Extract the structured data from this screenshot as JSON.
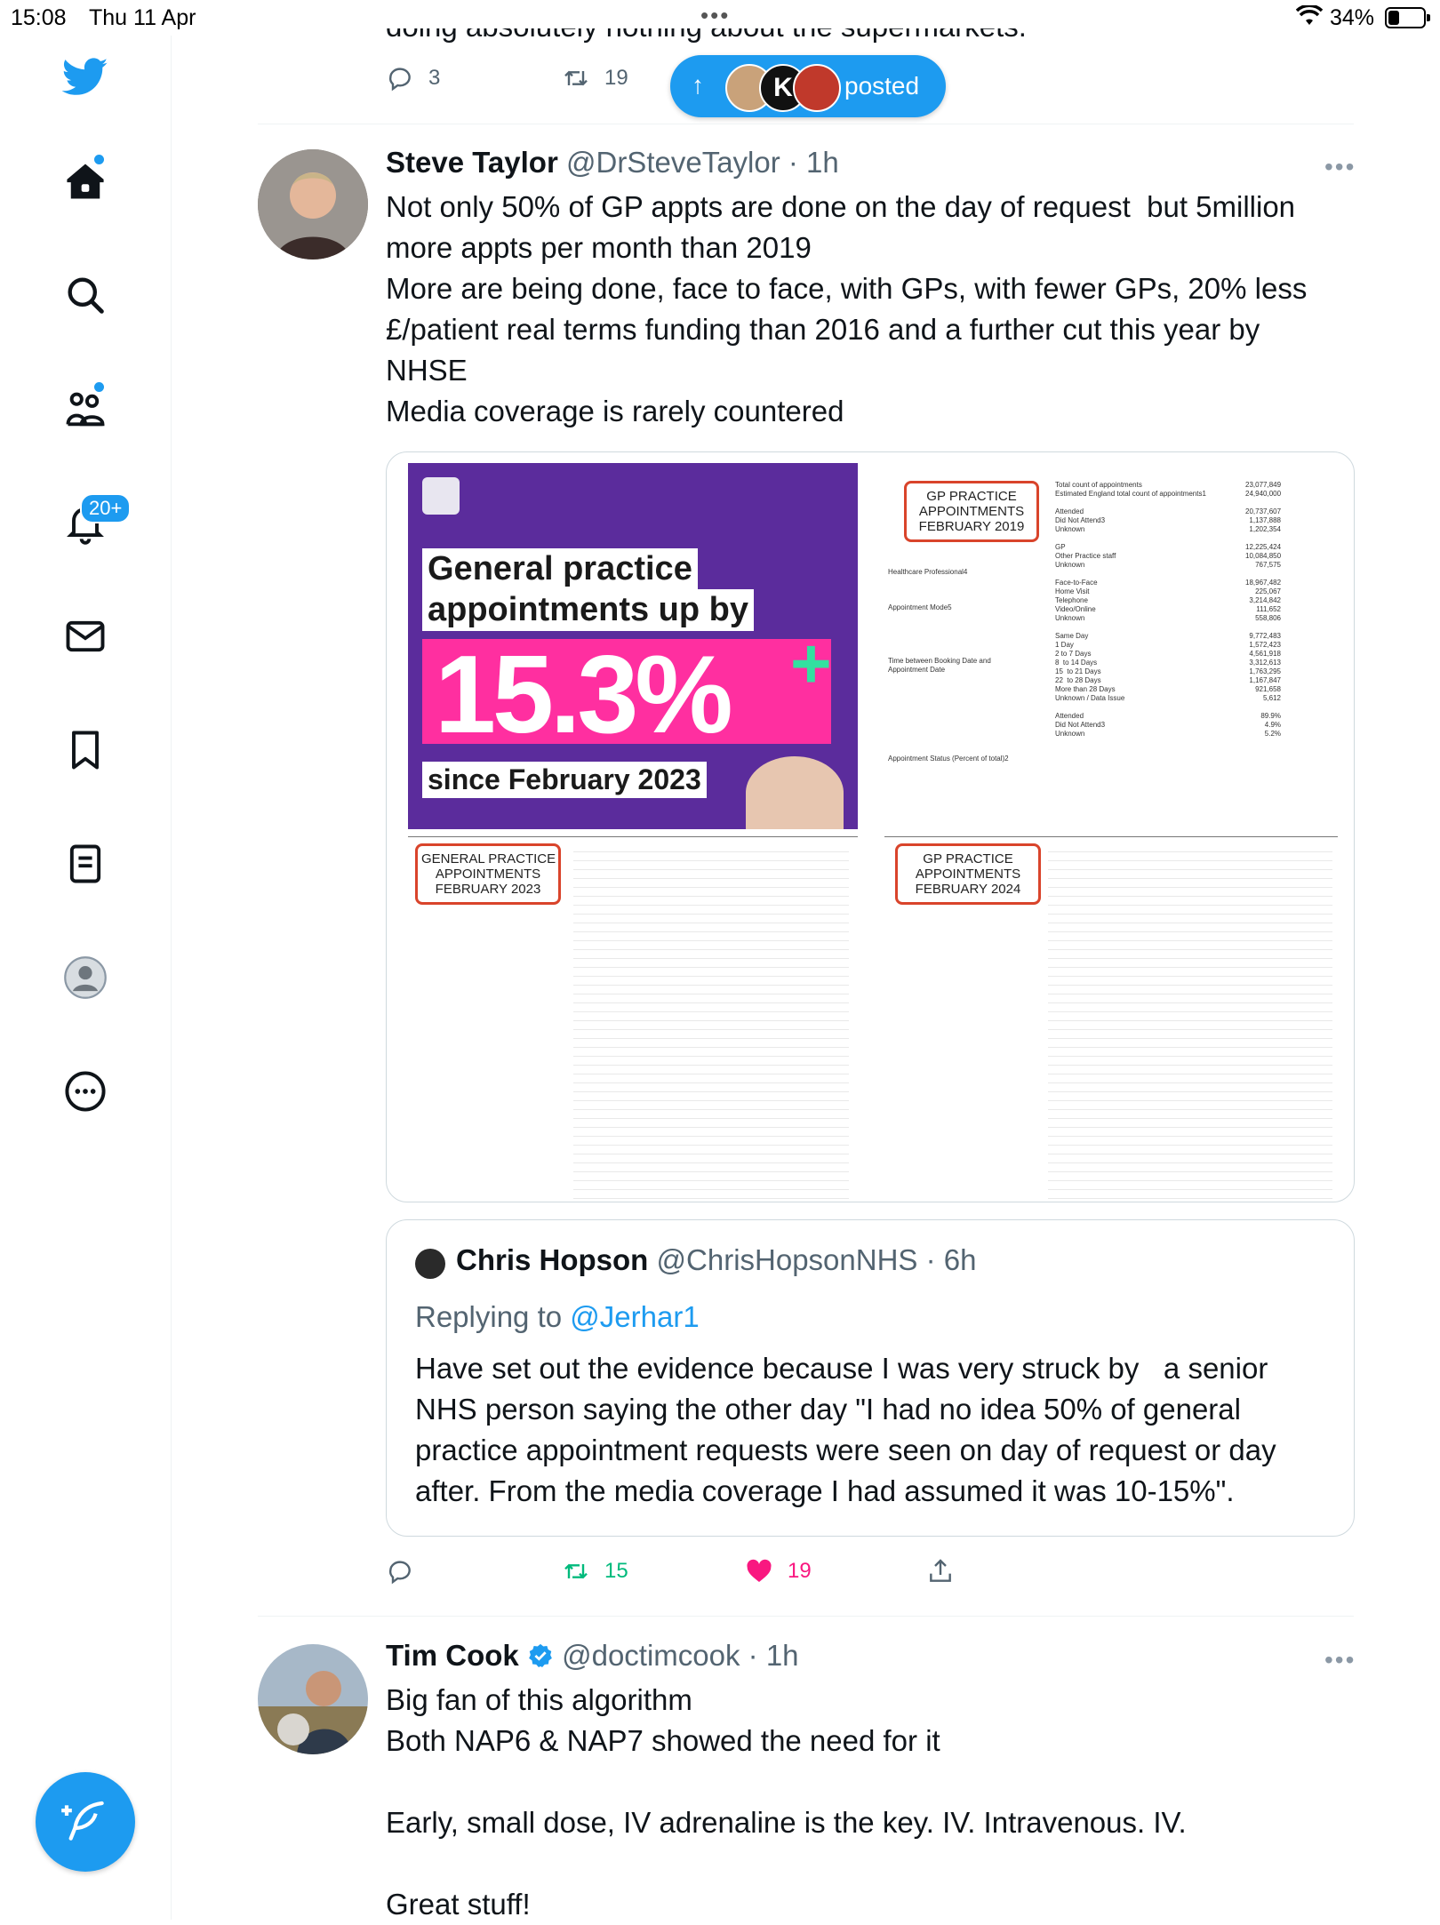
{
  "status_bar": {
    "time": "15:08",
    "date": "Thu 11 Apr",
    "battery": "34%"
  },
  "sidebar": {
    "notifications_badge": "20+"
  },
  "prev_tweet": {
    "partial_text": "doing absolutely nothing about the supermarkets.",
    "reply_count": "3",
    "retweet_count": "19"
  },
  "new_posts_pill": {
    "label": "posted"
  },
  "tweet1": {
    "name": "Steve Taylor",
    "handle": "@DrSteveTaylor",
    "time": "· 1h",
    "text": "Not only 50% of GP appts are done on the day of request  but 5million more appts per month than 2019\nMore are being done, face to face, with GPs, with fewer GPs, 20% less £/patient real terms funding than 2016 and a further cut this year by NHSE\nMedia coverage is rarely countered",
    "media": {
      "promo_line1": "General practice",
      "promo_line2": "appointments up by",
      "promo_pct": "15.3%",
      "promo_since": "since February 2023",
      "box_2019": "GP PRACTICE\nAPPOINTMENTS\nFEBRUARY 2019",
      "box_2023": "GENERAL PRACTICE\nAPPOINTMENTS\nFEBRUARY 2023",
      "box_2024": "GP PRACTICE\nAPPOINTMENTS\nFEBRUARY 2024",
      "table_2019_labels": "Total count of appointments\nEstimated England total count of appointments1\n\nAttended\nDid Not Attend3\nUnknown\n\nGP\nOther Practice staff\nUnknown\n\nFace-to-Face\nHome Visit\nTelephone\nVideo/Online\nUnknown\n\nSame Day\n1 Day\n2 to 7 Days\n8  to 14 Days\n15  to 21 Days\n22  to 28 Days\nMore than 28 Days\nUnknown / Data Issue\n\nAttended\nDid Not Attend3\nUnknown",
      "table_2019_values": "23,077,849\n24,940,000\n\n20,737,607\n1,137,888\n1,202,354\n\n12,225,424\n10,084,850\n767,575\n\n18,967,482\n225,067\n3,214,842\n111,652\n558,806\n\n9,772,483\n1,572,423\n4,561,918\n3,312,613\n1,763,295\n1,167,847\n921,658\n5,612\n\n89.9%\n4.9%\n5.2%",
      "table_2019_sections": "Healthcare Professional4\n\n\n\nAppointment Mode5\n\n\n\n\n\nTime between Booking Date and\nAppointment Date\n\n\n\n\n\n\n\n\n\nAppointment Status (Percent of total)2"
    },
    "reply_count": "",
    "retweet_count": "15",
    "like_count": "19"
  },
  "quoted": {
    "name": "Chris Hopson",
    "handle": "@ChrisHopsonNHS",
    "time": "· 6h",
    "replying_prefix": "Replying to",
    "replying_handle": "@Jerhar1",
    "text": "Have set out the evidence because I was very struck by   a senior NHS person saying the other day \"I had no idea 50% of general practice appointment requests were seen on day of request or day after. From the media coverage I had assumed it was 10-15%\"."
  },
  "tweet2": {
    "name": "Tim Cook",
    "handle": "@doctimcook",
    "time": "· 1h",
    "text": "Big fan of this algorithm\nBoth NAP6 & NAP7 showed the need for it\n\nEarly, small dose, IV adrenaline is the key. IV. Intravenous. IV.\n\nGreat stuff!"
  },
  "colors": {
    "accent": "#1d9bf0",
    "retweet_green": "#00ba7c",
    "like_pink": "#f91880",
    "muted": "#536471"
  }
}
